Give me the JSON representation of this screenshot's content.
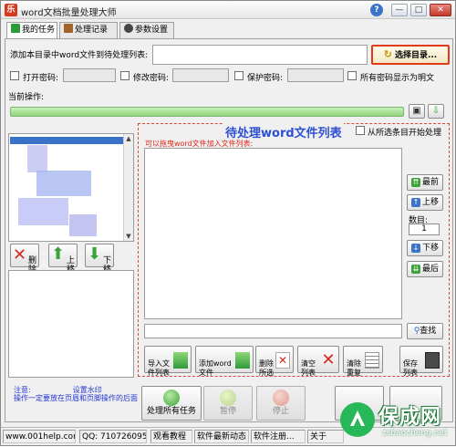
{
  "app": {
    "title": "word文档批量处理大师",
    "icon_glyph": "乐",
    "minimize_glyph": "—",
    "maximize_glyph": "□",
    "close_glyph": "✕",
    "help_glyph": "?"
  },
  "tabs": [
    {
      "label": "我的任务",
      "active": true,
      "icon": "play-icon"
    },
    {
      "label": "处理记录",
      "active": false,
      "icon": "briefcase-icon"
    },
    {
      "label": "参数设置",
      "active": false,
      "icon": "gear-icon"
    }
  ],
  "add_dir": {
    "label": "添加本目录中word文件到待处理列表:",
    "value": "",
    "button": "选择目录..."
  },
  "passwords": {
    "open_label": "打开密码:",
    "modify_label": "修改密码:",
    "protect_label": "保护密码:",
    "show_plain_label": "所有密码显示为明文"
  },
  "current_op_label": "当前操作:",
  "pending": {
    "title": "待处理word文件列表",
    "start_from_selected": "从所选条目开始处理",
    "hint": "可以拖曳word文件加入文件列表:",
    "count_label": "数目:",
    "count_value": "1"
  },
  "side_buttons": {
    "top": "最前",
    "up": "上移",
    "down": "下移",
    "bottom": "最后"
  },
  "left_buttons": {
    "delete": "删\n除",
    "up": "上\n移",
    "down": "下\n移"
  },
  "search_button": "查找",
  "actions": [
    {
      "label": "导入文\n件列表",
      "name": "import-list-button",
      "icon": "import-icon"
    },
    {
      "label": "添加word\n文件",
      "name": "add-word-button",
      "icon": "add-icon"
    },
    {
      "label": "删除\n所选",
      "name": "delete-selected-button",
      "icon": "delete-icon"
    },
    {
      "label": "清空\n列表",
      "name": "clear-list-button",
      "icon": "clear-icon"
    },
    {
      "label": "清除\n重复",
      "name": "remove-dup-button",
      "icon": "dedupe-icon"
    },
    {
      "label": "保存\n列表",
      "name": "save-list-button",
      "icon": "save-icon"
    }
  ],
  "note": {
    "line1": "注意:",
    "line1b": "设置水印",
    "line2": "操作一定要放在页眉和页脚操作的后面"
  },
  "run": {
    "process_all": "处理所有任务",
    "pause": "暂停",
    "stop": "停止"
  },
  "status": {
    "site": "www.001help.com",
    "qq": "QQ: 710726095",
    "tutorial": "观看教程",
    "news": "软件最新动态",
    "register": "软件注册...",
    "about": "关于"
  },
  "watermark": {
    "text": "保成网",
    "url": "zsbaocheng.net"
  },
  "colors": {
    "accent_red": "#e23a16",
    "title_blue": "#2d4fd4",
    "progress_green": "#8fd67a",
    "watermark_green": "#28b85a"
  }
}
